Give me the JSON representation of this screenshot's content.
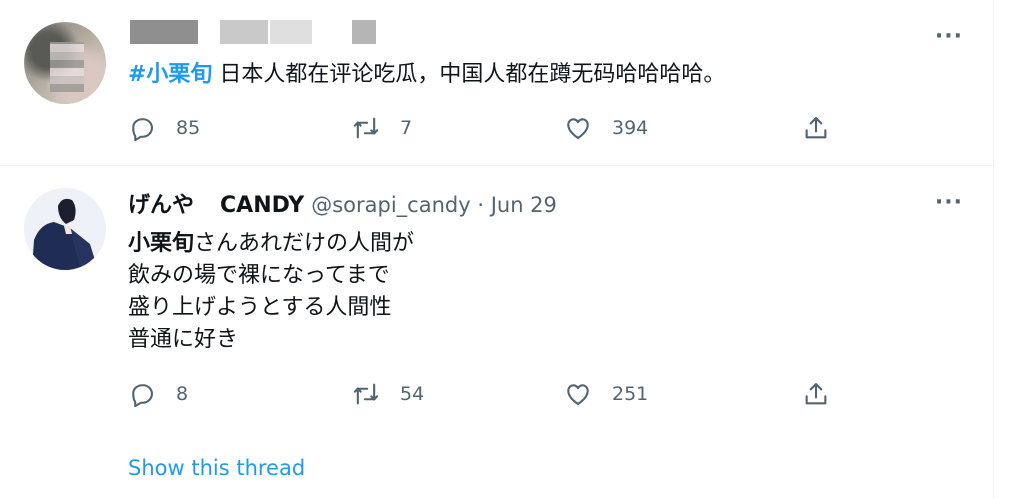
{
  "tweets": [
    {
      "hashtag": "#小栗旬",
      "text": " 日本人都在评论吃瓜，中国人都在蹲无码哈哈哈哈。",
      "reply_count": "85",
      "retweet_count": "7",
      "like_count": "394"
    },
    {
      "display_name": "げんや",
      "display_name_2": "CANDY",
      "handle": "@sorapi_candy",
      "separator": " · ",
      "date": "Jun 29",
      "text_bold": "小栗旬",
      "text_lines": [
        "さんあれだけの人間が",
        "飲みの場で裸になってまで",
        "盛り上げようとする人間性",
        "普通に好き"
      ],
      "reply_count": "8",
      "retweet_count": "54",
      "like_count": "251"
    }
  ],
  "more_label": "···",
  "show_thread_label": "Show this thread",
  "icons": {
    "reply": "reply-icon",
    "retweet": "retweet-icon",
    "like": "heart-icon",
    "share": "share-icon"
  },
  "colors": {
    "link": "#1d9bf0",
    "muted": "#536471",
    "text": "#0f1419"
  }
}
